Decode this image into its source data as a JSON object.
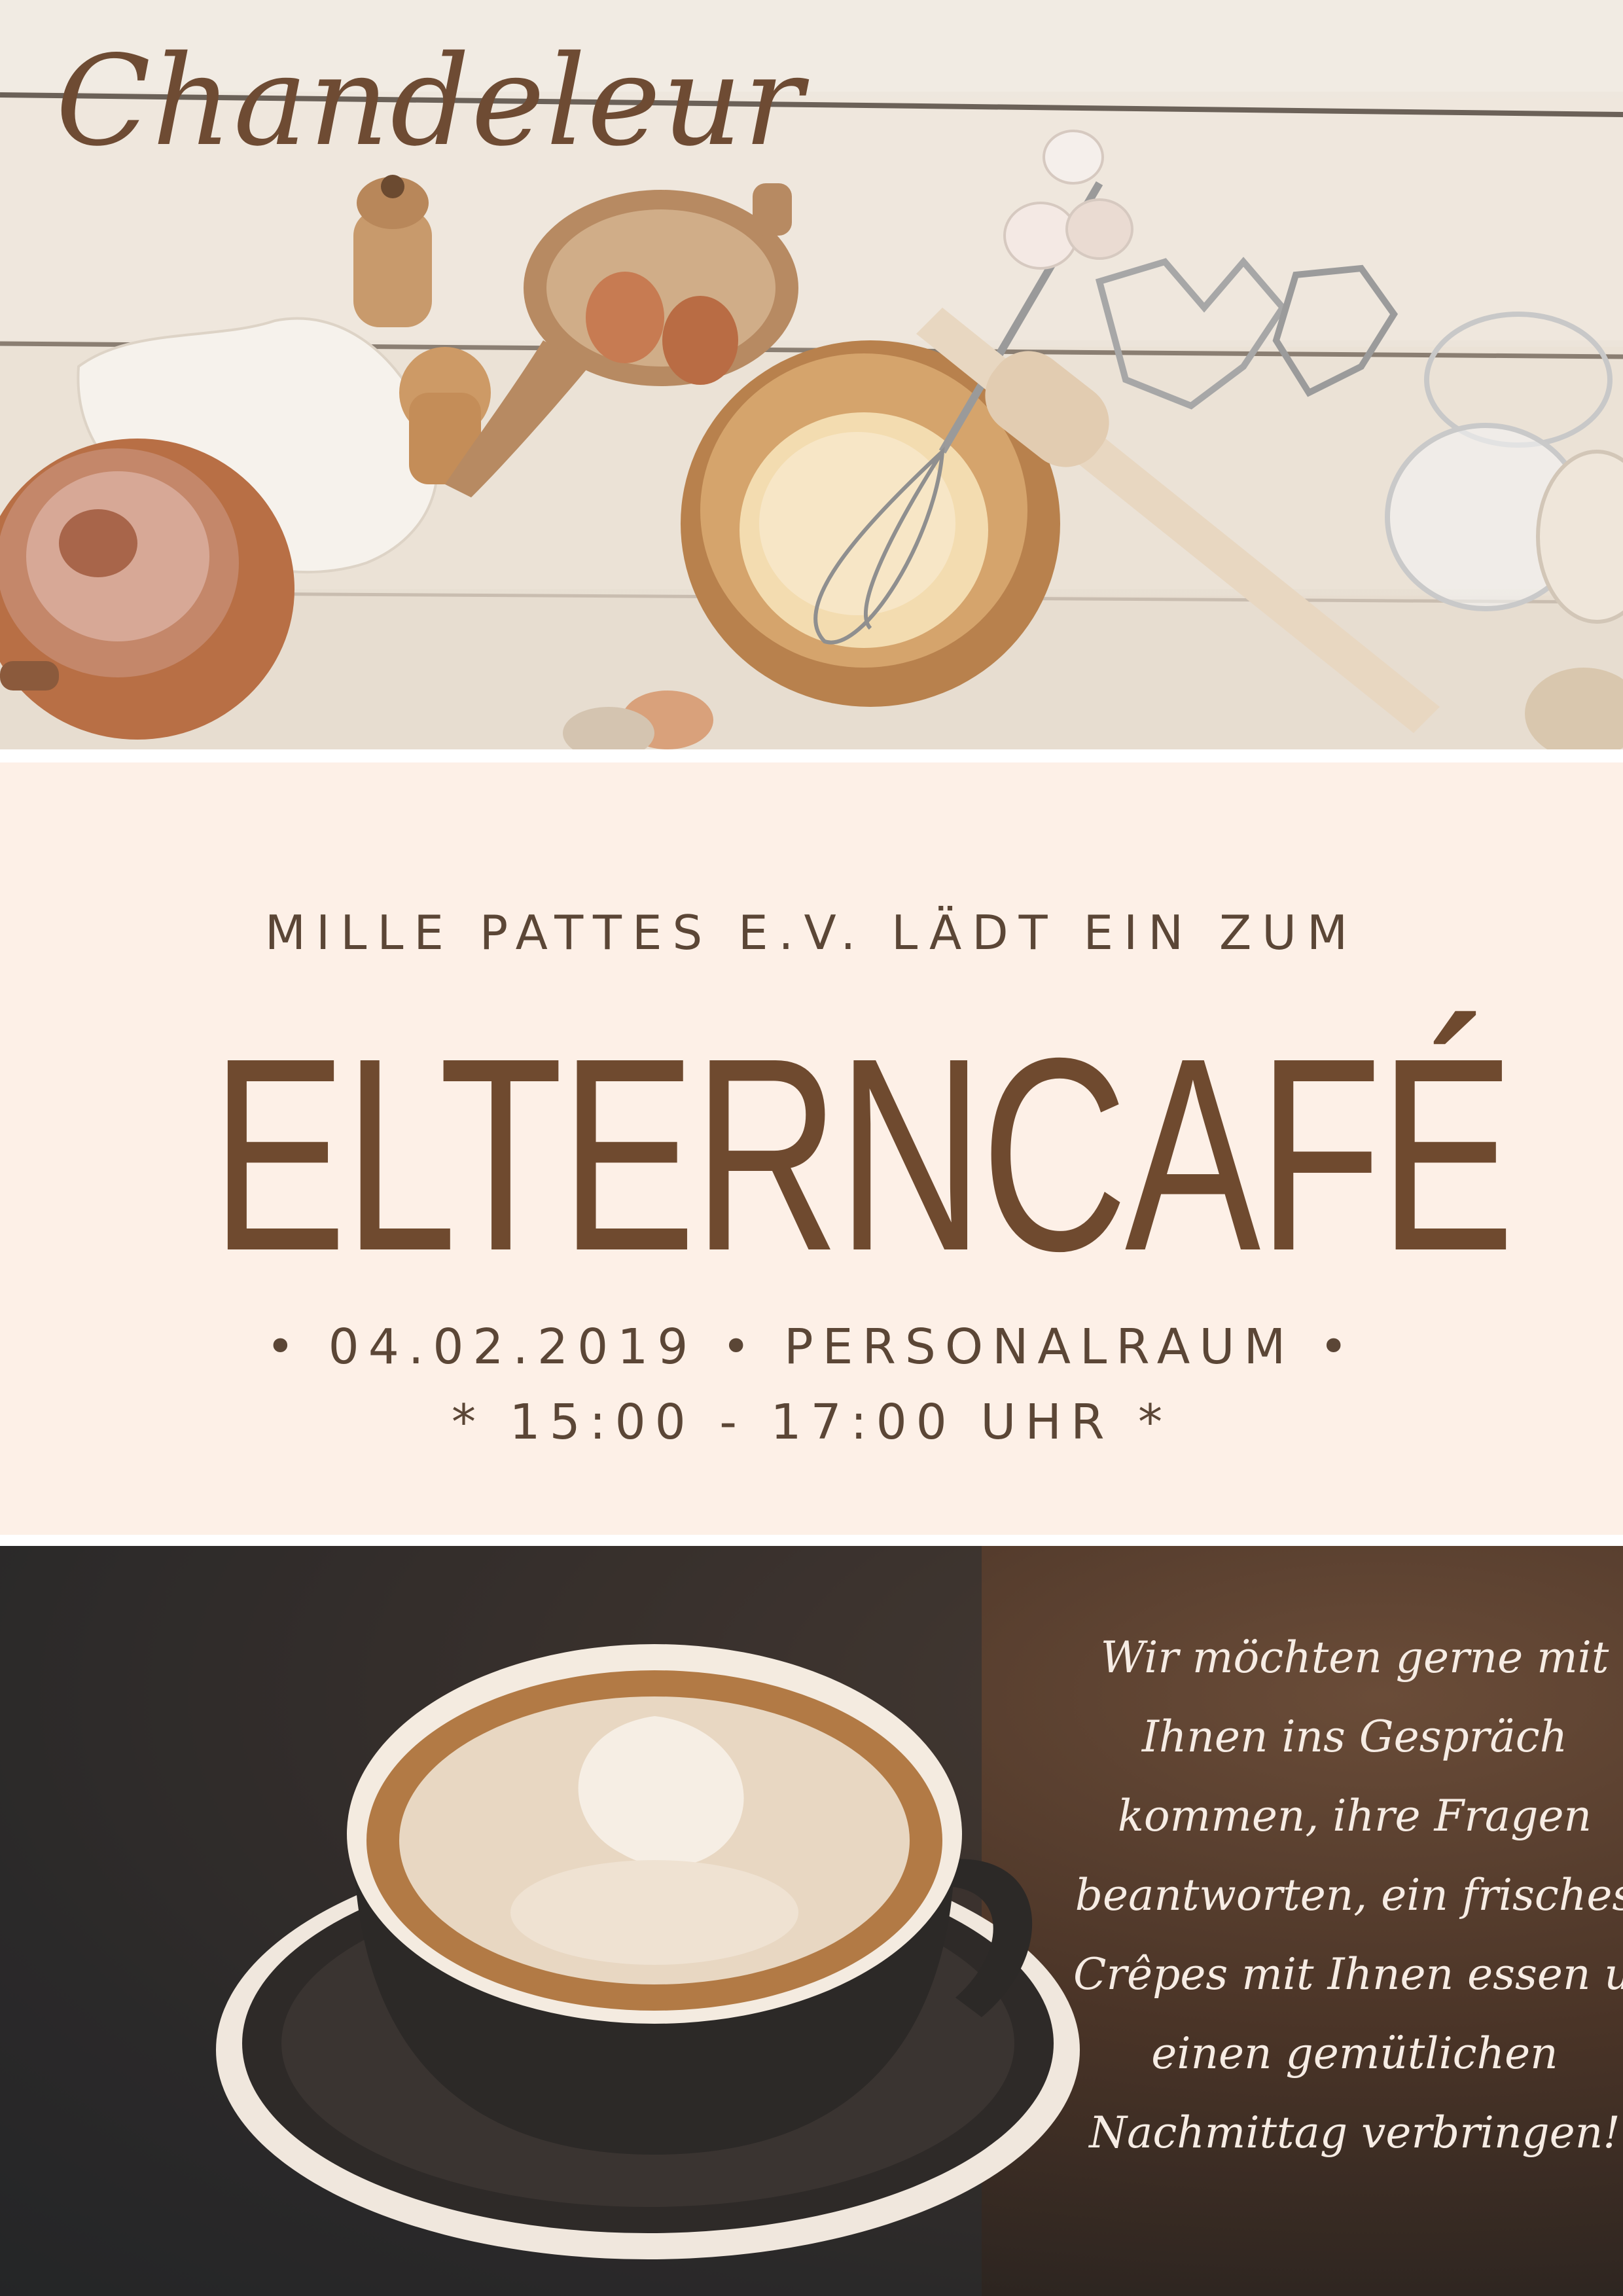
{
  "header": {
    "script_title": "Chandeleur"
  },
  "event": {
    "intro": "MILLE PATTES E.V. LÄDT EIN ZUM",
    "title": "ELTERNCAFÉ",
    "details_line1": "• 04.02.2019 • PERSONALRAUM •",
    "details_line2": "* 15:00 - 17:00 UHR *"
  },
  "invitation": {
    "lines": [
      "Wir möchten gerne mit",
      "Ihnen ins Gespräch",
      "kommen, ihre Fragen",
      "beantworten, ein frisches",
      "Crêpes mit Ihnen essen und",
      "einen gemütlichen",
      "Nachmittag verbringen!"
    ]
  },
  "colors": {
    "accent_brown": "#6f4a2f",
    "panel_background": "#fdf0e7",
    "text_dark": "#5b4636"
  },
  "images": {
    "top": "baking-ingredients-photo",
    "bottom": "cappuccino-cup-photo"
  }
}
